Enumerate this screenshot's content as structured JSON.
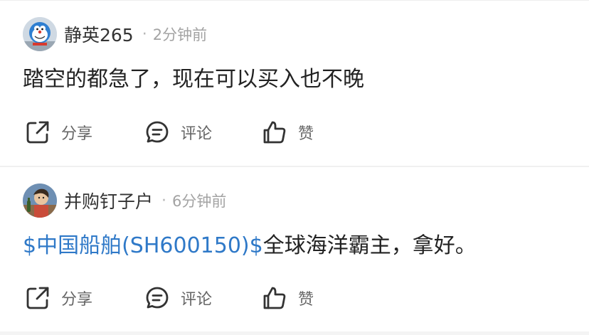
{
  "posts": [
    {
      "username": "静英265",
      "separator": "·",
      "time": "2分钟前",
      "content": "踏空的都急了，现在可以买入也不晚",
      "actions": {
        "share": "分享",
        "comment": "评论",
        "like": "赞"
      }
    },
    {
      "username": "并购钉子户",
      "separator": "·",
      "time": "6分钟前",
      "stock_link": "$中国船舶(SH600150)$",
      "content": "全球海洋霸主，拿好。",
      "actions": {
        "share": "分享",
        "comment": "评论",
        "like": "赞"
      }
    }
  ],
  "icons": {
    "share": "share-icon",
    "comment": "comment-icon",
    "like": "thumbs-up-icon"
  },
  "colors": {
    "link": "#2f79c8",
    "text": "#222222",
    "meta": "#a3a3a3",
    "action": "#666666"
  }
}
